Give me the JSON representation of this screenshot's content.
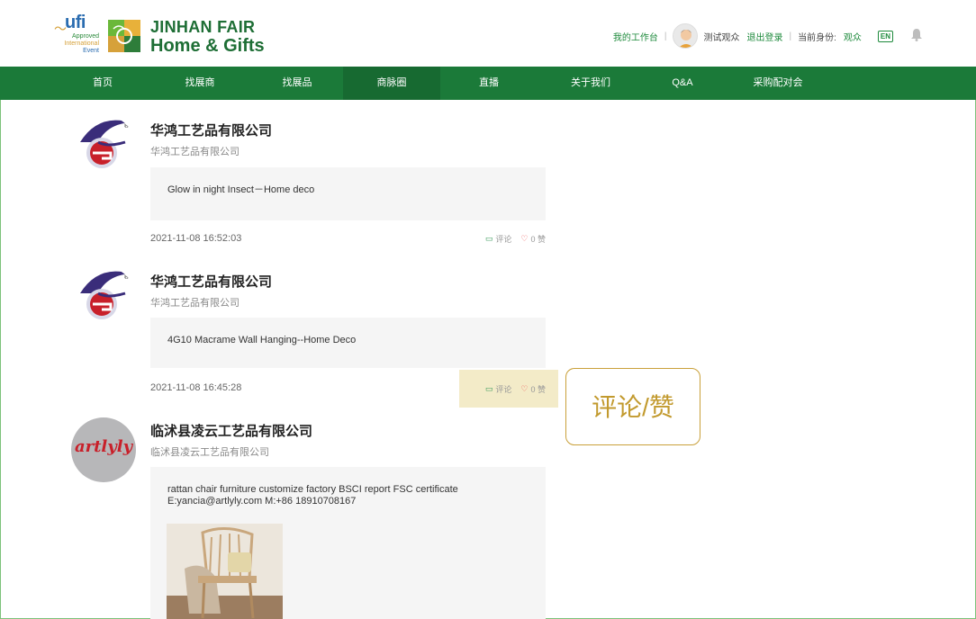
{
  "header": {
    "ufi_word": "ufi",
    "ufi_line1": "Approved",
    "ufi_line2": "International",
    "ufi_line3": "Event",
    "brand_top": "JINHAN FAIR",
    "brand_bottom": "Home & Gifts",
    "workspace": "我的工作台",
    "user_name": "测试观众",
    "logout": "退出登录",
    "identity_label": "当前身份:",
    "identity_value": "观众",
    "lang": "EN"
  },
  "nav": [
    {
      "label": "首页"
    },
    {
      "label": "找展商"
    },
    {
      "label": "找展品"
    },
    {
      "label": "商脉圈"
    },
    {
      "label": "直播"
    },
    {
      "label": "关于我们"
    },
    {
      "label": "Q&A"
    },
    {
      "label": "采购配对会"
    }
  ],
  "posts": [
    {
      "company": "华鸿工艺品有限公司",
      "subtitle": "华鸿工艺品有限公司",
      "content": "Glow in night Insect－Home deco",
      "time": "2021-11-08 16:52:03",
      "comment": "评论",
      "likes": "0 赞"
    },
    {
      "company": "华鸿工艺品有限公司",
      "subtitle": "华鸿工艺品有限公司",
      "content": "4G10 Macrame Wall Hanging--Home Deco",
      "time": "2021-11-08 16:45:28",
      "comment": "评论",
      "likes": "0 赞"
    },
    {
      "company": "临沭县凌云工艺品有限公司",
      "subtitle": "临沭县凌云工艺品有限公司",
      "content_line1": "rattan chair furniture customize factory BSCI report FSC certificate",
      "content_line2": "E:yancia@artlyly.com M:+86 18910708167",
      "logo_text": "artlyly"
    }
  ],
  "callout": "评论/赞",
  "colors": {
    "nav_bg": "#1b7a39",
    "brand_green": "#1e6e35",
    "highlight": "#f3ebc8",
    "callout_border": "#c9a03a"
  }
}
